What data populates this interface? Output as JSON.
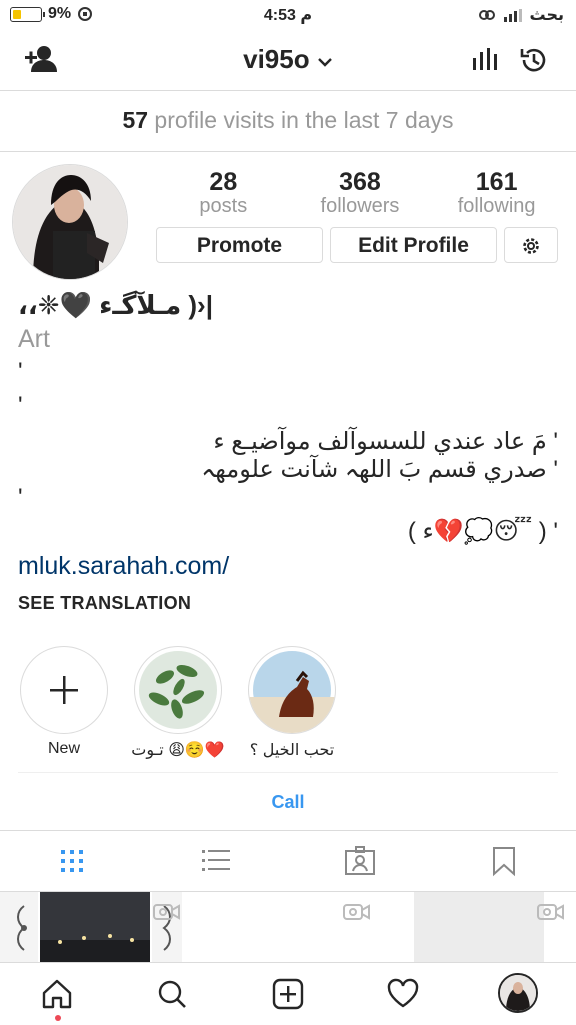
{
  "status": {
    "battery": "9%",
    "time": "4:53 م",
    "carrier": "بحث"
  },
  "header": {
    "username": "vi95o",
    "add_user_icon": "add-person-icon",
    "insights_icon": "bar-chart-icon",
    "archive_icon": "history-icon"
  },
  "visits": {
    "count": "57",
    "text": "profile visits in the last 7 days"
  },
  "stats": [
    {
      "num": "28",
      "label": "posts"
    },
    {
      "num": "368",
      "label": "followers"
    },
    {
      "num": "161",
      "label": "following"
    }
  ],
  "buttons": {
    "promote": "Promote",
    "edit": "Edit Profile"
  },
  "bio": {
    "name": "|‹( مـلآگـء 🖤❈،،",
    "category": "Art",
    "lines": [
      "'",
      "'",
      "' مَ عاد عندي للسسوآلف موآضيـع ء",
      "' صدري قسم بَ اللهہ شآنت علومهہ",
      "'",
      "' ( 😴💭💔ء )"
    ],
    "link": "mluk.sarahah.com/",
    "translate": "SEE TRANSLATION"
  },
  "stories": [
    {
      "label": "New"
    },
    {
      "label": "تـوت 😩☺️❤️"
    },
    {
      "label": "تحب الخيل ؟"
    }
  ],
  "call": "Call",
  "colors": {
    "accent": "#3897f0",
    "link": "#003569",
    "muted": "#999999"
  }
}
